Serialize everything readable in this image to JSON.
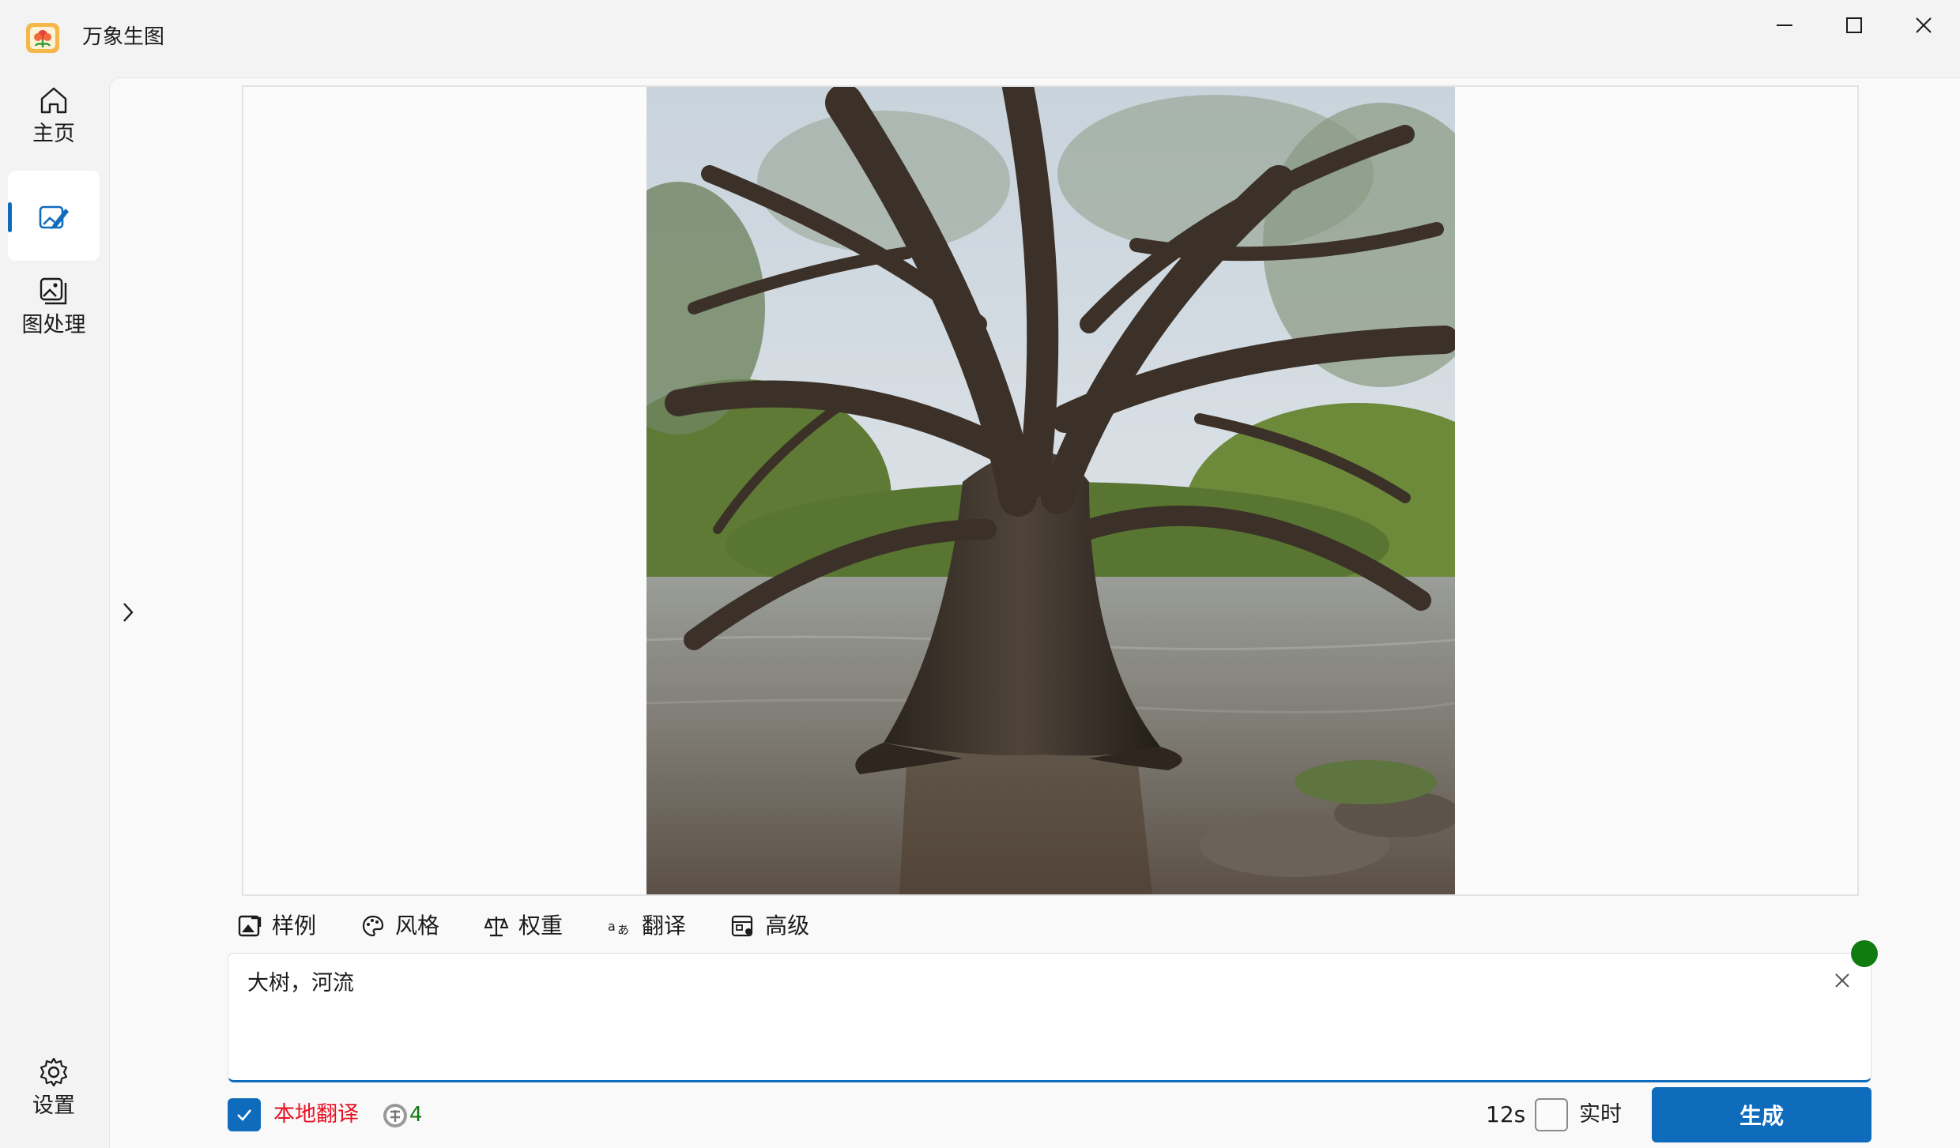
{
  "window": {
    "title": "万象生图",
    "icons": {
      "app": "app-flower-icon",
      "minimize": "minimize-icon",
      "maximize": "maximize-icon",
      "close": "close-icon"
    }
  },
  "nav": {
    "items": [
      {
        "label": "主页",
        "icon": "home-icon"
      },
      {
        "label": "",
        "icon": "image-edit-icon",
        "active": true
      },
      {
        "label": "图处理",
        "icon": "image-process-icon"
      }
    ],
    "settings": {
      "label": "设置",
      "icon": "gear-icon"
    }
  },
  "toolbar": {
    "items": [
      {
        "label": "样例",
        "icon": "image-samples-icon"
      },
      {
        "label": "风格",
        "icon": "palette-icon"
      },
      {
        "label": "权重",
        "icon": "scale-icon"
      },
      {
        "label": "翻译",
        "icon": "translate-icon"
      },
      {
        "label": "高级",
        "icon": "advanced-settings-icon"
      }
    ]
  },
  "prompt": {
    "value": "大树，河流"
  },
  "bottom": {
    "local_translate": {
      "label": "本地翻译",
      "checked": true
    },
    "translate_count": "4",
    "timer": "12s",
    "realtime": {
      "label": "实时",
      "checked": false
    },
    "generate_label": "生成"
  },
  "colors": {
    "accent": "#0f6cbd",
    "status": "#107c10",
    "warning": "#e81123"
  }
}
